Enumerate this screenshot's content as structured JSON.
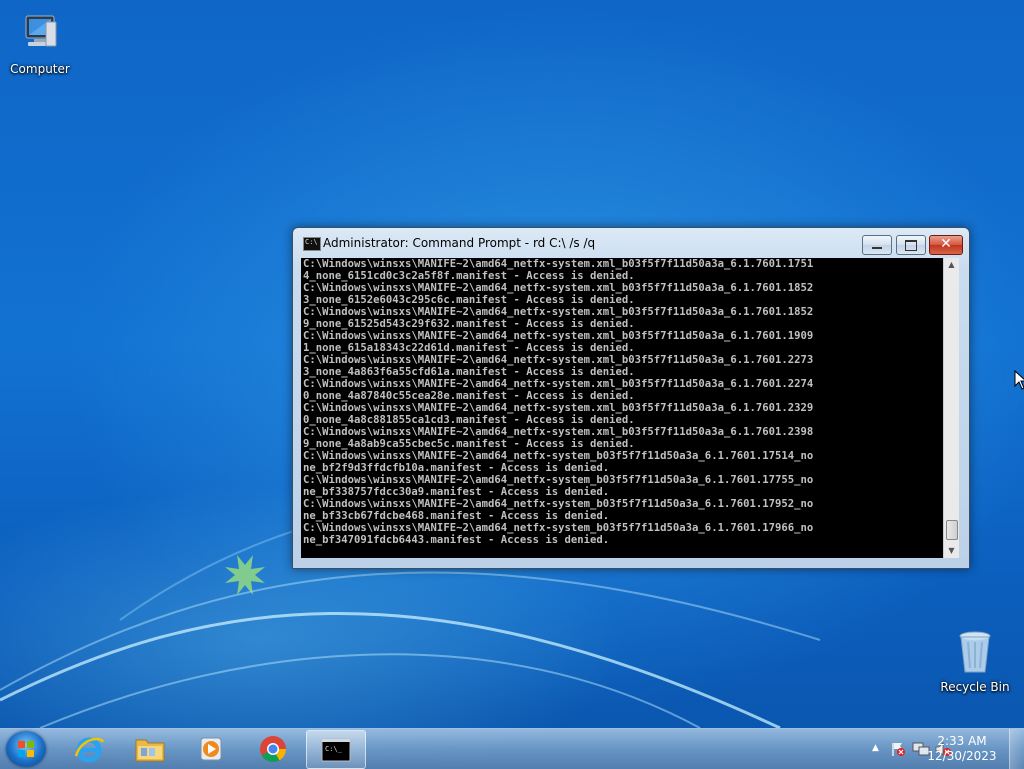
{
  "desktop": {
    "icons": [
      {
        "label": "Computer",
        "icon": "computer-icon"
      },
      {
        "label": "Recycle Bin",
        "icon": "recycle-bin-icon"
      }
    ]
  },
  "window": {
    "title": "Administrator:  Command Prompt - rd  C:\\ /s /q",
    "icon": "cmd-icon",
    "controls": {
      "minimize": "minimize-icon",
      "maximize": "maximize-icon",
      "close": "✕"
    },
    "console_lines": [
      "C:\\Windows\\winsxs\\MANIFE~2\\amd64_netfx-system.xml_b03f5f7f11d50a3a_6.1.7601.1751",
      "4_none_6151cd0c3c2a5f8f.manifest - Access is denied.",
      "C:\\Windows\\winsxs\\MANIFE~2\\amd64_netfx-system.xml_b03f5f7f11d50a3a_6.1.7601.1852",
      "3_none_6152e6043c295c6c.manifest - Access is denied.",
      "C:\\Windows\\winsxs\\MANIFE~2\\amd64_netfx-system.xml_b03f5f7f11d50a3a_6.1.7601.1852",
      "9_none_61525d543c29f632.manifest - Access is denied.",
      "C:\\Windows\\winsxs\\MANIFE~2\\amd64_netfx-system.xml_b03f5f7f11d50a3a_6.1.7601.1909",
      "1_none_615a18343c22d61d.manifest - Access is denied.",
      "C:\\Windows\\winsxs\\MANIFE~2\\amd64_netfx-system.xml_b03f5f7f11d50a3a_6.1.7601.2273",
      "3_none_4a863f6a55cfd61a.manifest - Access is denied.",
      "C:\\Windows\\winsxs\\MANIFE~2\\amd64_netfx-system.xml_b03f5f7f11d50a3a_6.1.7601.2274",
      "0_none_4a87840c55cea28e.manifest - Access is denied.",
      "C:\\Windows\\winsxs\\MANIFE~2\\amd64_netfx-system.xml_b03f5f7f11d50a3a_6.1.7601.2329",
      "0_none_4a8c881855ca1cd3.manifest - Access is denied.",
      "C:\\Windows\\winsxs\\MANIFE~2\\amd64_netfx-system.xml_b03f5f7f11d50a3a_6.1.7601.2398",
      "9_none_4a8ab9ca55cbec5c.manifest - Access is denied.",
      "C:\\Windows\\winsxs\\MANIFE~2\\amd64_netfx-system_b03f5f7f11d50a3a_6.1.7601.17514_no",
      "ne_bf2f9d3ffdcfb10a.manifest - Access is denied.",
      "C:\\Windows\\winsxs\\MANIFE~2\\amd64_netfx-system_b03f5f7f11d50a3a_6.1.7601.17755_no",
      "ne_bf338757fdcc30a9.manifest - Access is denied.",
      "C:\\Windows\\winsxs\\MANIFE~2\\amd64_netfx-system_b03f5f7f11d50a3a_6.1.7601.17952_no",
      "ne_bf33cb67fdcbe468.manifest - Access is denied.",
      "C:\\Windows\\winsxs\\MANIFE~2\\amd64_netfx-system_b03f5f7f11d50a3a_6.1.7601.17966_no",
      "ne_bf347091fdcb6443.manifest - Access is denied."
    ]
  },
  "taskbar": {
    "pinned": [
      {
        "name": "internet-explorer",
        "icon": "internet-explorer-icon"
      },
      {
        "name": "file-explorer",
        "icon": "folder-icon"
      },
      {
        "name": "media-player",
        "icon": "media-player-icon"
      },
      {
        "name": "chrome",
        "icon": "chrome-icon"
      },
      {
        "name": "command-prompt",
        "icon": "cmd-icon",
        "active": true
      }
    ],
    "tray_icons": [
      "show-hidden-icons-icon",
      "action-center-flag-icon",
      "network-icon",
      "volume-muted-icon"
    ],
    "clock": {
      "time": "2:33 AM",
      "date": "12/30/2023"
    }
  },
  "colors": {
    "console_bg": "#000000",
    "console_text": "#c0c0c0",
    "close_button": "#c7432a"
  }
}
